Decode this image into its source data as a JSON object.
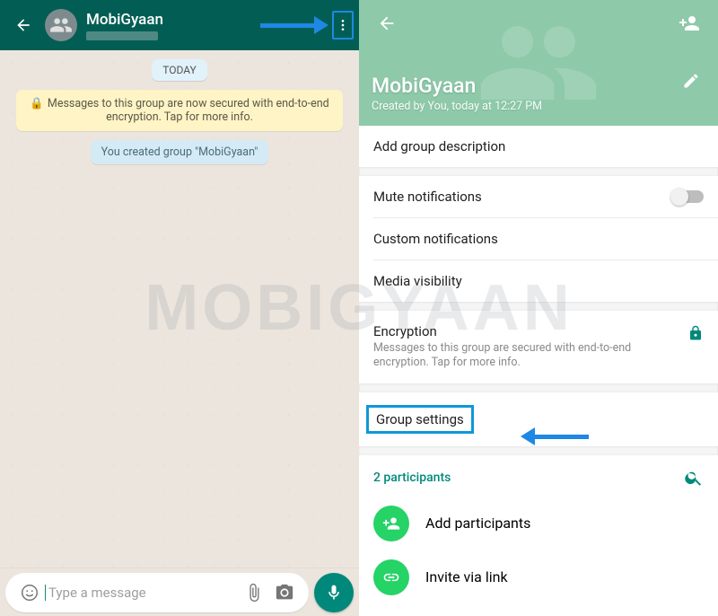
{
  "left": {
    "header": {
      "title": "MobiGyaan"
    },
    "date_label": "TODAY",
    "encryption_notice": "Messages to this group are now secured with end-to-end encryption. Tap for more info.",
    "created_notice": "You created group \"MobiGyaan\"",
    "input_placeholder": "Type a message"
  },
  "right": {
    "title": "MobiGyaan",
    "subtitle": "Created by You, today at 12:27 PM",
    "add_description": "Add group description",
    "mute": "Mute notifications",
    "custom_notifications": "Custom notifications",
    "media_visibility": "Media visibility",
    "encryption_title": "Encryption",
    "encryption_sub": "Messages to this group are secured with end-to-end encryption. Tap for more info.",
    "group_settings": "Group settings",
    "participants_count": "2 participants",
    "add_participants": "Add participants",
    "invite_link": "Invite via link"
  },
  "watermark": "MOBIGYAAN"
}
